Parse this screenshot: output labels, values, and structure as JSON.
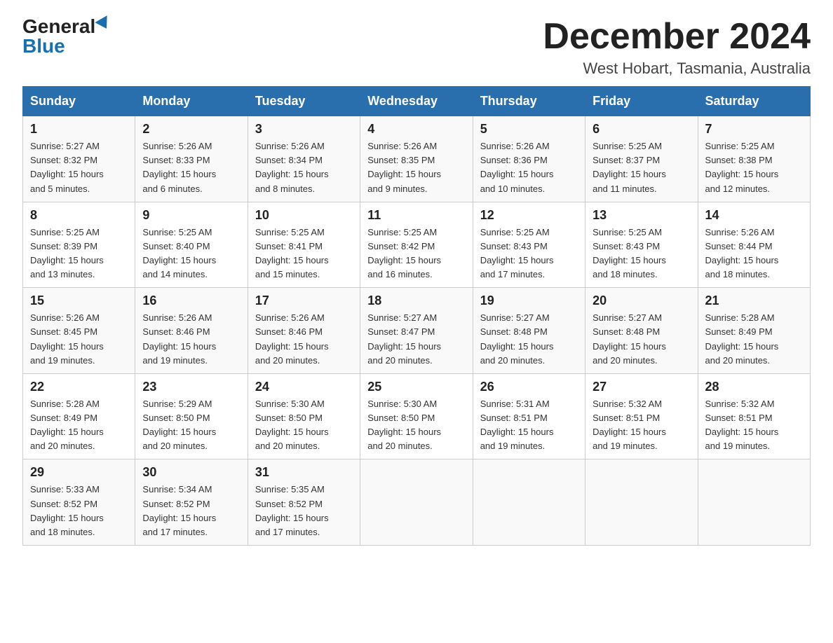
{
  "header": {
    "logo_general": "General",
    "logo_blue": "Blue",
    "month_title": "December 2024",
    "location": "West Hobart, Tasmania, Australia"
  },
  "days_of_week": [
    "Sunday",
    "Monday",
    "Tuesday",
    "Wednesday",
    "Thursday",
    "Friday",
    "Saturday"
  ],
  "weeks": [
    [
      {
        "day": "1",
        "sunrise": "5:27 AM",
        "sunset": "8:32 PM",
        "daylight": "15 hours and 5 minutes."
      },
      {
        "day": "2",
        "sunrise": "5:26 AM",
        "sunset": "8:33 PM",
        "daylight": "15 hours and 6 minutes."
      },
      {
        "day": "3",
        "sunrise": "5:26 AM",
        "sunset": "8:34 PM",
        "daylight": "15 hours and 8 minutes."
      },
      {
        "day": "4",
        "sunrise": "5:26 AM",
        "sunset": "8:35 PM",
        "daylight": "15 hours and 9 minutes."
      },
      {
        "day": "5",
        "sunrise": "5:26 AM",
        "sunset": "8:36 PM",
        "daylight": "15 hours and 10 minutes."
      },
      {
        "day": "6",
        "sunrise": "5:25 AM",
        "sunset": "8:37 PM",
        "daylight": "15 hours and 11 minutes."
      },
      {
        "day": "7",
        "sunrise": "5:25 AM",
        "sunset": "8:38 PM",
        "daylight": "15 hours and 12 minutes."
      }
    ],
    [
      {
        "day": "8",
        "sunrise": "5:25 AM",
        "sunset": "8:39 PM",
        "daylight": "15 hours and 13 minutes."
      },
      {
        "day": "9",
        "sunrise": "5:25 AM",
        "sunset": "8:40 PM",
        "daylight": "15 hours and 14 minutes."
      },
      {
        "day": "10",
        "sunrise": "5:25 AM",
        "sunset": "8:41 PM",
        "daylight": "15 hours and 15 minutes."
      },
      {
        "day": "11",
        "sunrise": "5:25 AM",
        "sunset": "8:42 PM",
        "daylight": "15 hours and 16 minutes."
      },
      {
        "day": "12",
        "sunrise": "5:25 AM",
        "sunset": "8:43 PM",
        "daylight": "15 hours and 17 minutes."
      },
      {
        "day": "13",
        "sunrise": "5:25 AM",
        "sunset": "8:43 PM",
        "daylight": "15 hours and 18 minutes."
      },
      {
        "day": "14",
        "sunrise": "5:26 AM",
        "sunset": "8:44 PM",
        "daylight": "15 hours and 18 minutes."
      }
    ],
    [
      {
        "day": "15",
        "sunrise": "5:26 AM",
        "sunset": "8:45 PM",
        "daylight": "15 hours and 19 minutes."
      },
      {
        "day": "16",
        "sunrise": "5:26 AM",
        "sunset": "8:46 PM",
        "daylight": "15 hours and 19 minutes."
      },
      {
        "day": "17",
        "sunrise": "5:26 AM",
        "sunset": "8:46 PM",
        "daylight": "15 hours and 20 minutes."
      },
      {
        "day": "18",
        "sunrise": "5:27 AM",
        "sunset": "8:47 PM",
        "daylight": "15 hours and 20 minutes."
      },
      {
        "day": "19",
        "sunrise": "5:27 AM",
        "sunset": "8:48 PM",
        "daylight": "15 hours and 20 minutes."
      },
      {
        "day": "20",
        "sunrise": "5:27 AM",
        "sunset": "8:48 PM",
        "daylight": "15 hours and 20 minutes."
      },
      {
        "day": "21",
        "sunrise": "5:28 AM",
        "sunset": "8:49 PM",
        "daylight": "15 hours and 20 minutes."
      }
    ],
    [
      {
        "day": "22",
        "sunrise": "5:28 AM",
        "sunset": "8:49 PM",
        "daylight": "15 hours and 20 minutes."
      },
      {
        "day": "23",
        "sunrise": "5:29 AM",
        "sunset": "8:50 PM",
        "daylight": "15 hours and 20 minutes."
      },
      {
        "day": "24",
        "sunrise": "5:30 AM",
        "sunset": "8:50 PM",
        "daylight": "15 hours and 20 minutes."
      },
      {
        "day": "25",
        "sunrise": "5:30 AM",
        "sunset": "8:50 PM",
        "daylight": "15 hours and 20 minutes."
      },
      {
        "day": "26",
        "sunrise": "5:31 AM",
        "sunset": "8:51 PM",
        "daylight": "15 hours and 19 minutes."
      },
      {
        "day": "27",
        "sunrise": "5:32 AM",
        "sunset": "8:51 PM",
        "daylight": "15 hours and 19 minutes."
      },
      {
        "day": "28",
        "sunrise": "5:32 AM",
        "sunset": "8:51 PM",
        "daylight": "15 hours and 19 minutes."
      }
    ],
    [
      {
        "day": "29",
        "sunrise": "5:33 AM",
        "sunset": "8:52 PM",
        "daylight": "15 hours and 18 minutes."
      },
      {
        "day": "30",
        "sunrise": "5:34 AM",
        "sunset": "8:52 PM",
        "daylight": "15 hours and 17 minutes."
      },
      {
        "day": "31",
        "sunrise": "5:35 AM",
        "sunset": "8:52 PM",
        "daylight": "15 hours and 17 minutes."
      },
      null,
      null,
      null,
      null
    ]
  ],
  "labels": {
    "sunrise": "Sunrise:",
    "sunset": "Sunset:",
    "daylight": "Daylight:"
  }
}
